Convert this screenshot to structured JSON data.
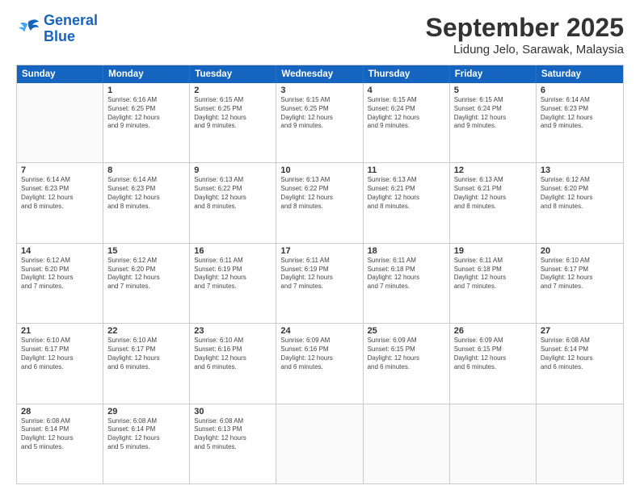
{
  "logo": {
    "line1": "General",
    "line2": "Blue"
  },
  "title": "September 2025",
  "location": "Lidung Jelo, Sarawak, Malaysia",
  "days_of_week": [
    "Sunday",
    "Monday",
    "Tuesday",
    "Wednesday",
    "Thursday",
    "Friday",
    "Saturday"
  ],
  "weeks": [
    [
      {
        "day": "",
        "info": ""
      },
      {
        "day": "1",
        "info": "Sunrise: 6:16 AM\nSunset: 6:25 PM\nDaylight: 12 hours\nand 9 minutes."
      },
      {
        "day": "2",
        "info": "Sunrise: 6:15 AM\nSunset: 6:25 PM\nDaylight: 12 hours\nand 9 minutes."
      },
      {
        "day": "3",
        "info": "Sunrise: 6:15 AM\nSunset: 6:25 PM\nDaylight: 12 hours\nand 9 minutes."
      },
      {
        "day": "4",
        "info": "Sunrise: 6:15 AM\nSunset: 6:24 PM\nDaylight: 12 hours\nand 9 minutes."
      },
      {
        "day": "5",
        "info": "Sunrise: 6:15 AM\nSunset: 6:24 PM\nDaylight: 12 hours\nand 9 minutes."
      },
      {
        "day": "6",
        "info": "Sunrise: 6:14 AM\nSunset: 6:23 PM\nDaylight: 12 hours\nand 9 minutes."
      }
    ],
    [
      {
        "day": "7",
        "info": "Sunrise: 6:14 AM\nSunset: 6:23 PM\nDaylight: 12 hours\nand 8 minutes."
      },
      {
        "day": "8",
        "info": "Sunrise: 6:14 AM\nSunset: 6:23 PM\nDaylight: 12 hours\nand 8 minutes."
      },
      {
        "day": "9",
        "info": "Sunrise: 6:13 AM\nSunset: 6:22 PM\nDaylight: 12 hours\nand 8 minutes."
      },
      {
        "day": "10",
        "info": "Sunrise: 6:13 AM\nSunset: 6:22 PM\nDaylight: 12 hours\nand 8 minutes."
      },
      {
        "day": "11",
        "info": "Sunrise: 6:13 AM\nSunset: 6:21 PM\nDaylight: 12 hours\nand 8 minutes."
      },
      {
        "day": "12",
        "info": "Sunrise: 6:13 AM\nSunset: 6:21 PM\nDaylight: 12 hours\nand 8 minutes."
      },
      {
        "day": "13",
        "info": "Sunrise: 6:12 AM\nSunset: 6:20 PM\nDaylight: 12 hours\nand 8 minutes."
      }
    ],
    [
      {
        "day": "14",
        "info": "Sunrise: 6:12 AM\nSunset: 6:20 PM\nDaylight: 12 hours\nand 7 minutes."
      },
      {
        "day": "15",
        "info": "Sunrise: 6:12 AM\nSunset: 6:20 PM\nDaylight: 12 hours\nand 7 minutes."
      },
      {
        "day": "16",
        "info": "Sunrise: 6:11 AM\nSunset: 6:19 PM\nDaylight: 12 hours\nand 7 minutes."
      },
      {
        "day": "17",
        "info": "Sunrise: 6:11 AM\nSunset: 6:19 PM\nDaylight: 12 hours\nand 7 minutes."
      },
      {
        "day": "18",
        "info": "Sunrise: 6:11 AM\nSunset: 6:18 PM\nDaylight: 12 hours\nand 7 minutes."
      },
      {
        "day": "19",
        "info": "Sunrise: 6:11 AM\nSunset: 6:18 PM\nDaylight: 12 hours\nand 7 minutes."
      },
      {
        "day": "20",
        "info": "Sunrise: 6:10 AM\nSunset: 6:17 PM\nDaylight: 12 hours\nand 7 minutes."
      }
    ],
    [
      {
        "day": "21",
        "info": "Sunrise: 6:10 AM\nSunset: 6:17 PM\nDaylight: 12 hours\nand 6 minutes."
      },
      {
        "day": "22",
        "info": "Sunrise: 6:10 AM\nSunset: 6:17 PM\nDaylight: 12 hours\nand 6 minutes."
      },
      {
        "day": "23",
        "info": "Sunrise: 6:10 AM\nSunset: 6:16 PM\nDaylight: 12 hours\nand 6 minutes."
      },
      {
        "day": "24",
        "info": "Sunrise: 6:09 AM\nSunset: 6:16 PM\nDaylight: 12 hours\nand 6 minutes."
      },
      {
        "day": "25",
        "info": "Sunrise: 6:09 AM\nSunset: 6:15 PM\nDaylight: 12 hours\nand 6 minutes."
      },
      {
        "day": "26",
        "info": "Sunrise: 6:09 AM\nSunset: 6:15 PM\nDaylight: 12 hours\nand 6 minutes."
      },
      {
        "day": "27",
        "info": "Sunrise: 6:08 AM\nSunset: 6:14 PM\nDaylight: 12 hours\nand 6 minutes."
      }
    ],
    [
      {
        "day": "28",
        "info": "Sunrise: 6:08 AM\nSunset: 6:14 PM\nDaylight: 12 hours\nand 5 minutes."
      },
      {
        "day": "29",
        "info": "Sunrise: 6:08 AM\nSunset: 6:14 PM\nDaylight: 12 hours\nand 5 minutes."
      },
      {
        "day": "30",
        "info": "Sunrise: 6:08 AM\nSunset: 6:13 PM\nDaylight: 12 hours\nand 5 minutes."
      },
      {
        "day": "",
        "info": ""
      },
      {
        "day": "",
        "info": ""
      },
      {
        "day": "",
        "info": ""
      },
      {
        "day": "",
        "info": ""
      }
    ]
  ]
}
